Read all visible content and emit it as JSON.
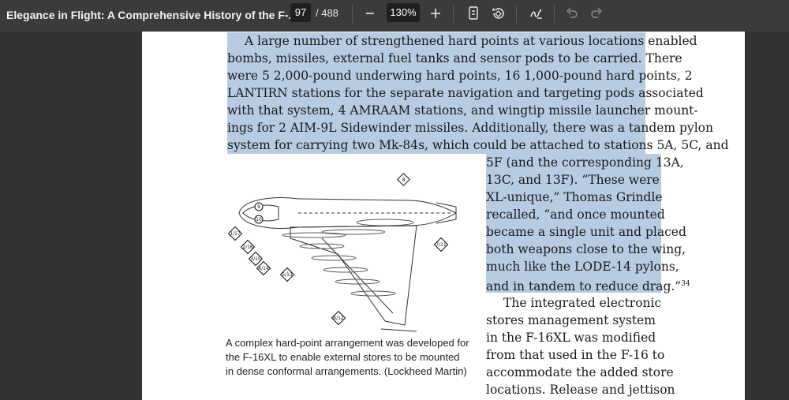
{
  "toolbar": {
    "document_title": "Elegance in Flight: A Comprehensive History of the F-...",
    "current_page": "97",
    "total_pages": "/ 488",
    "zoom_out_icon": "minus-icon",
    "zoom_level": "130%",
    "zoom_in_icon": "plus-icon",
    "page_view_icon": "page-view-icon",
    "rotate_icon": "rotate-icon",
    "draw_icon": "draw-icon",
    "undo_icon": "undo-icon",
    "redo_icon": "redo-icon"
  },
  "highlight_color": "#b7cbe3",
  "body_lines": [
    "A large number of strengthened hard points at various locations enabled",
    "bombs, missiles, external fuel tanks and sensor pods to be carried. There",
    "were 5 2,000-pound underwing hard points, 16 1,000-pound hard points, 2",
    "LANTIRN stations for the separate navigation and targeting pods associated",
    "with that system, 4 AMRAAM stations, and wingtip missile launcher mount-",
    "ings for 2 AIM-9L Sidewinder missiles. Additionally, there was a tandem pylon",
    "system for carrying two Mk-84s, which could be attached to stations 5A, 5C, and"
  ],
  "column_lines": [
    "5F (and the corresponding 13A,",
    "13C, and 13F). “These were",
    "XL-unique,” Thomas Grindle",
    "recalled, “and once mounted",
    "became a single unit and placed",
    "both weapons close to the wing,",
    "much like the LODE-14 pylons,",
    "and in tandem to reduce drag.”"
  ],
  "footnote": "34",
  "column_lines_unhighlighted": [
    "The integrated electronic",
    "stores management system",
    "in the F-16XL was modified",
    "from that used in the F-16 to",
    "accommodate the added store",
    "locations. Release and jettison"
  ],
  "caption_lines": [
    "A complex hard-point arrangement was developed for",
    "the F-16XL to enable external stores to be mounted",
    "in dense conformal arrangements. (Lockheed Martin)"
  ],
  "figure_labels": [
    "8",
    "1/17",
    "2/16",
    "3/15",
    "4/14",
    "5/13",
    "6/12",
    "7/11",
    "9",
    "10"
  ]
}
